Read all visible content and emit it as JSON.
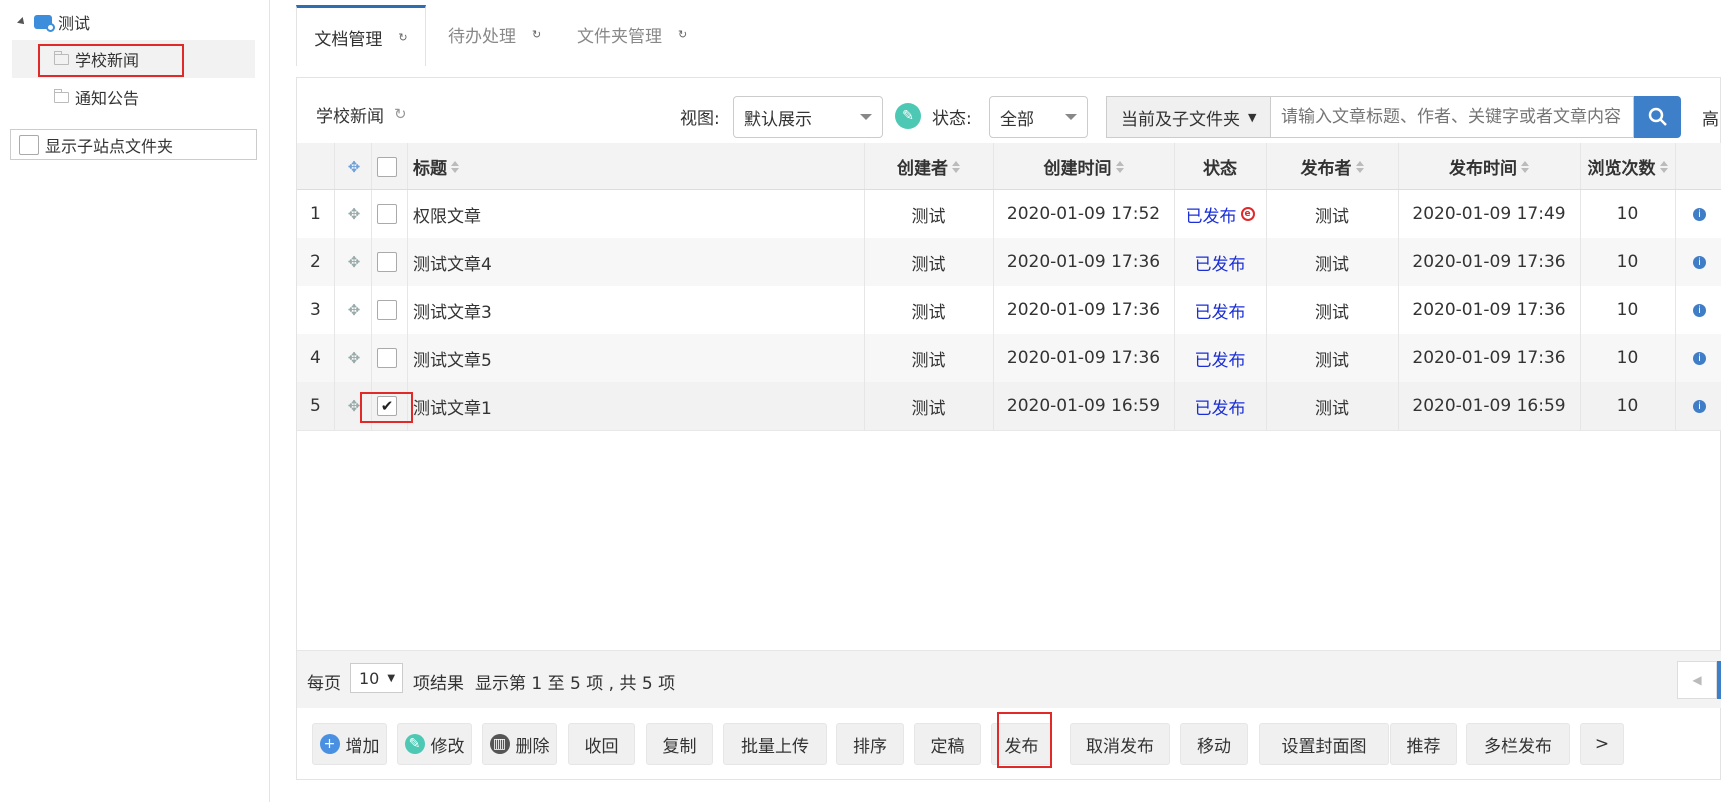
{
  "sidebar": {
    "root_label": "测试",
    "items": [
      {
        "label": "学校新闻"
      },
      {
        "label": "通知公告"
      }
    ],
    "show_sub_sites_label": "显示子站点文件夹"
  },
  "tabs": [
    {
      "label": "文档管理"
    },
    {
      "label": "待办处理"
    },
    {
      "label": "文件夹管理"
    }
  ],
  "toolbar": {
    "folder_title": "学校新闻",
    "view_label": "视图:",
    "view_value": "默认展示",
    "status_label": "状态:",
    "status_value": "全部",
    "scope_value": "当前及子文件夹",
    "search_placeholder": "请输入文章标题、作者、关键字或者文章内容",
    "advanced_label": "高"
  },
  "table": {
    "columns": {
      "title": "标题",
      "creator": "创建者",
      "created": "创建时间",
      "status": "状态",
      "publisher": "发布者",
      "published": "发布时间",
      "views": "浏览次数"
    },
    "rows": [
      {
        "index": "1",
        "title": "权限文章",
        "creator": "测试",
        "created": "2020-01-09 17:52",
        "status": "已发布",
        "publisher": "测试",
        "published": "2020-01-09 17:49",
        "views": "10"
      },
      {
        "index": "2",
        "title": "测试文章4",
        "creator": "测试",
        "created": "2020-01-09 17:36",
        "status": "已发布",
        "publisher": "测试",
        "published": "2020-01-09 17:36",
        "views": "10"
      },
      {
        "index": "3",
        "title": "测试文章3",
        "creator": "测试",
        "created": "2020-01-09 17:36",
        "status": "已发布",
        "publisher": "测试",
        "published": "2020-01-09 17:36",
        "views": "10"
      },
      {
        "index": "4",
        "title": "测试文章5",
        "creator": "测试",
        "created": "2020-01-09 17:36",
        "status": "已发布",
        "publisher": "测试",
        "published": "2020-01-09 17:36",
        "views": "10"
      },
      {
        "index": "5",
        "title": "测试文章1",
        "creator": "测试",
        "created": "2020-01-09 16:59",
        "status": "已发布",
        "publisher": "测试",
        "published": "2020-01-09 16:59",
        "views": "10"
      }
    ]
  },
  "pagination": {
    "per_page_label": "每页",
    "per_page_value": "10",
    "results_label": "项结果",
    "summary": "显示第 1 至 5 项 , 共 5 项"
  },
  "actions": {
    "add": "增加",
    "edit": "修改",
    "delete": "删除",
    "recall": "收回",
    "copy": "复制",
    "batch_upload": "批量上传",
    "sort": "排序",
    "finalize": "定稿",
    "publish": "发布",
    "unpublish": "取消发布",
    "move": "移动",
    "set_cover": "设置封面图",
    "recommend": "推荐",
    "multi_publish": "多栏发布",
    "more": ">"
  },
  "colors": {
    "accent": "#3d7fc9",
    "status_link": "#1a2fd6",
    "highlight": "#e02a2a",
    "edit_green": "#4cc8b5"
  }
}
